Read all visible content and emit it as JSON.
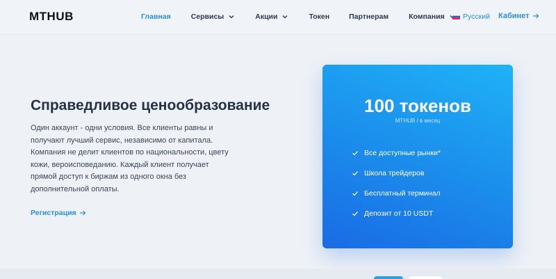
{
  "header": {
    "logo": "MTHUB",
    "nav": [
      {
        "label": "Главная",
        "active": true,
        "has_dropdown": false
      },
      {
        "label": "Сервисы",
        "active": false,
        "has_dropdown": true
      },
      {
        "label": "Акции",
        "active": false,
        "has_dropdown": true
      },
      {
        "label": "Токен",
        "active": false,
        "has_dropdown": false
      },
      {
        "label": "Партнерам",
        "active": false,
        "has_dropdown": false
      },
      {
        "label": "Компания",
        "active": false,
        "has_dropdown": true
      }
    ],
    "language": {
      "label": "Русский",
      "flag": "russia-flag-icon"
    },
    "cabinet": {
      "label": "Кабинет",
      "icon": "arrow-right-icon"
    }
  },
  "hero": {
    "title": "Справедливое ценообразование",
    "text": "Один аккаунт - одни условия. Все клиенты равны и получают лучший сервис, независимо от капитала. Компания не делит клиентов по национальности, цвету кожи, вероисповеданию. Каждый клиент получает прямой доступ к биржам из одного окна без дополнительной оплаты.",
    "register_label": "Регистрация"
  },
  "card": {
    "title": "100 токенов",
    "subtitle": "MTHUB / в месяц",
    "features": [
      "Все доступные рынки*",
      "Школа трейдеров",
      "Бесплатный терминал",
      "Депозит от 10 USDT"
    ]
  },
  "colors": {
    "accent": "#2b8fe0",
    "card_gradient_start": "#1fb2f6",
    "card_gradient_end": "#1a6be4",
    "background": "#eef1f6"
  }
}
